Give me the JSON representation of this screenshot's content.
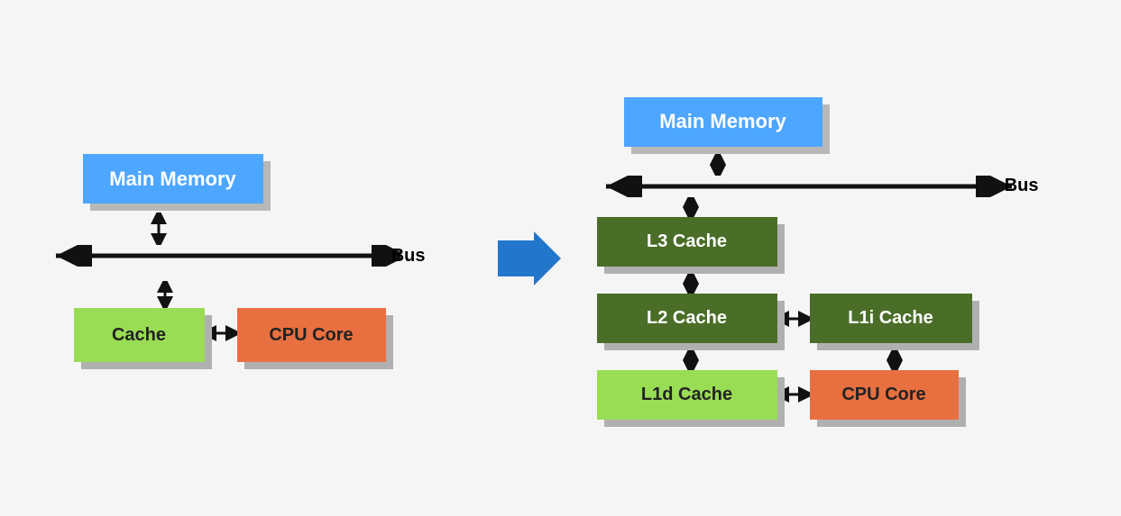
{
  "left": {
    "main_memory_label": "Main Memory",
    "bus_label": "Bus",
    "cache_label": "Cache",
    "cpu_core_label": "CPU Core"
  },
  "right": {
    "main_memory_label": "Main Memory",
    "bus_label": "Bus",
    "l3_cache_label": "L3 Cache",
    "l2_cache_label": "L2 Cache",
    "l1i_cache_label": "L1i Cache",
    "l1d_cache_label": "L1d Cache",
    "cpu_core_label": "CPU Core"
  },
  "arrow": "➤"
}
